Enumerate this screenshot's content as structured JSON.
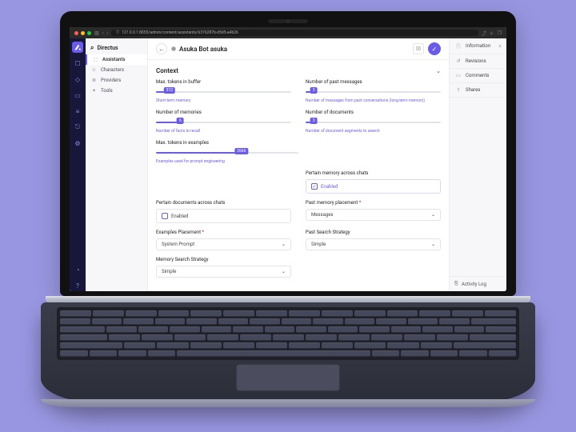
{
  "browser": {
    "url": "127.0.0.1:8055/admin/content/assistants/6376287b-d5d5-a4b26"
  },
  "brand": "Directus",
  "header": {
    "title": "Asuka Bot asuka"
  },
  "nav": {
    "items": [
      {
        "label": "Assistants"
      },
      {
        "label": "Characters"
      },
      {
        "label": "Providers"
      },
      {
        "label": "Tools"
      }
    ]
  },
  "section": {
    "title": "Context"
  },
  "fields": {
    "max_tokens_buffer": {
      "label": "Max. tokens in buffer",
      "value": "512",
      "hint": "Short-term memory",
      "pct": 10
    },
    "past_messages": {
      "label": "Number of past messages",
      "value": "3",
      "hint": "Number of messages from past conversations (long-term memory)",
      "pct": 6
    },
    "memories": {
      "label": "Number of memories",
      "value": "6",
      "hint": "Number of facts to recall",
      "pct": 18
    },
    "documents": {
      "label": "Number of documents",
      "value": "3",
      "hint": "Number of document segments to search",
      "pct": 6
    },
    "max_tokens_examples": {
      "label": "Max. tokens in examples",
      "value": "2666",
      "hint": "Examples used for prompt engineering",
      "pct": 60
    },
    "pertain_memory": {
      "label": "Pertain memory across chats",
      "value": "Enabled",
      "checked": true
    },
    "pertain_docs": {
      "label": "Pertain documents across chats",
      "value": "Enabled",
      "checked": false
    },
    "past_placement": {
      "label": "Past memory placement",
      "value": "Messages"
    },
    "examples_placement": {
      "label": "Examples Placement",
      "value": "System Prompt"
    },
    "past_search": {
      "label": "Past Search Strategy",
      "value": "Simple"
    },
    "memory_search": {
      "label": "Memory Search Strategy",
      "value": "Simple"
    }
  },
  "rightpanel": {
    "items": [
      {
        "label": "Information"
      },
      {
        "label": "Revisions"
      },
      {
        "label": "Comments"
      },
      {
        "label": "Shares"
      }
    ],
    "footer": "Activity Log"
  }
}
